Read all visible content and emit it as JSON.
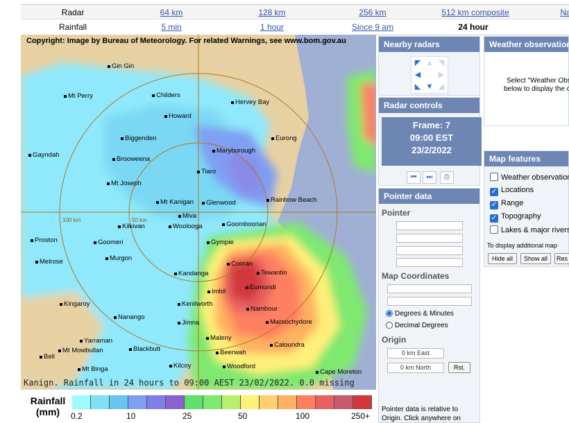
{
  "radar_row": {
    "label": "Radar",
    "links": [
      "64 km",
      "128 km",
      "256 km",
      "512 km composite",
      "Na"
    ]
  },
  "rainfall_row": {
    "label": "Rainfall",
    "links": [
      "5 min",
      "1 hour",
      "Since 9 am"
    ],
    "current": "24 hour"
  },
  "map": {
    "copyright": "Copyright: Image by Bureau of Meteorology. For related Warnings, see www.bom.gov.au",
    "caption": "Kanign. Rainfall in 24 hours to 09:00 AEST 23/02/2022. 0.0 missing",
    "ring_labels": [
      "100 km",
      "50 km"
    ],
    "towns": [
      "Gin Gin",
      "Mt Perry",
      "Childers",
      "Hervey Bay",
      "Howard",
      "Biggenden",
      "Eurong",
      "Gayndah",
      "Brooweena",
      "Maryborough",
      "Tiaro",
      "Mt Joseph",
      "Mt Kanigan",
      "Glenwood",
      "Rainbow Beach",
      "Kilkivan",
      "Miva",
      "Woolooga",
      "Goomboorian",
      "Proston",
      "Goomeri",
      "Gympie",
      "Melrose",
      "Murgon",
      "Cooran",
      "Kandanga",
      "Tewantin",
      "Eumundi",
      "Imbil",
      "Kingaroy",
      "Kenilworth",
      "Nambour",
      "Nanango",
      "Jimna",
      "Maroochydore",
      "Maleny",
      "Yarraman",
      "Mt Mowbullan",
      "Blackbutt",
      "Caloundra",
      "Beerwah",
      "Bell",
      "Mt Binga",
      "Kilcoy",
      "Woodford",
      "Cape Moreton"
    ]
  },
  "legend": {
    "title": "Rainfall (mm)",
    "ticks": [
      "0.2",
      "10",
      "25",
      "50",
      "100",
      "250+"
    ],
    "colors": [
      "#9cfcff",
      "#7fe0f6",
      "#68c4f0",
      "#7f9ff2",
      "#7f7fe8",
      "#8a62d0",
      "#5fe06e",
      "#7fe86f",
      "#b8f06e",
      "#fff07a",
      "#ffd070",
      "#ffb060",
      "#ff8060",
      "#e86060",
      "#c85a6e",
      "#d0383c"
    ]
  },
  "nearby_radars": {
    "title": "Nearby radars"
  },
  "radar_controls": {
    "title": "Radar controls",
    "frame": "Frame: 7",
    "time": "09:00 EST",
    "date": "23/2/2022"
  },
  "pointer_data": {
    "title": "Pointer data",
    "pointer_label": "Pointer",
    "coords_label": "Map Coordinates",
    "opt_dm": "Degrees & Minutes",
    "opt_dd": "Decimal Degrees",
    "origin_label": "Origin",
    "origin_east": "0 km East",
    "origin_north": "0 km North",
    "reset": "Rst.",
    "note_1": "Pointer data is relative to",
    "note_2": "Origin. Click anywhere on"
  },
  "weather_obs": {
    "title": "Weather observation",
    "line_1": "Select \"Weather Obs",
    "line_2": "below to display the o"
  },
  "map_features": {
    "title": "Map features",
    "items": [
      {
        "label": "Weather observation",
        "checked": false
      },
      {
        "label": "Locations",
        "checked": true
      },
      {
        "label": "Range",
        "checked": true
      },
      {
        "label": "Topography",
        "checked": true
      },
      {
        "label": "Lakes & major rivers",
        "checked": false
      }
    ],
    "note": "To display additional map",
    "hide_all": "Hide all",
    "show_all": "Show all",
    "reset": "Res"
  }
}
